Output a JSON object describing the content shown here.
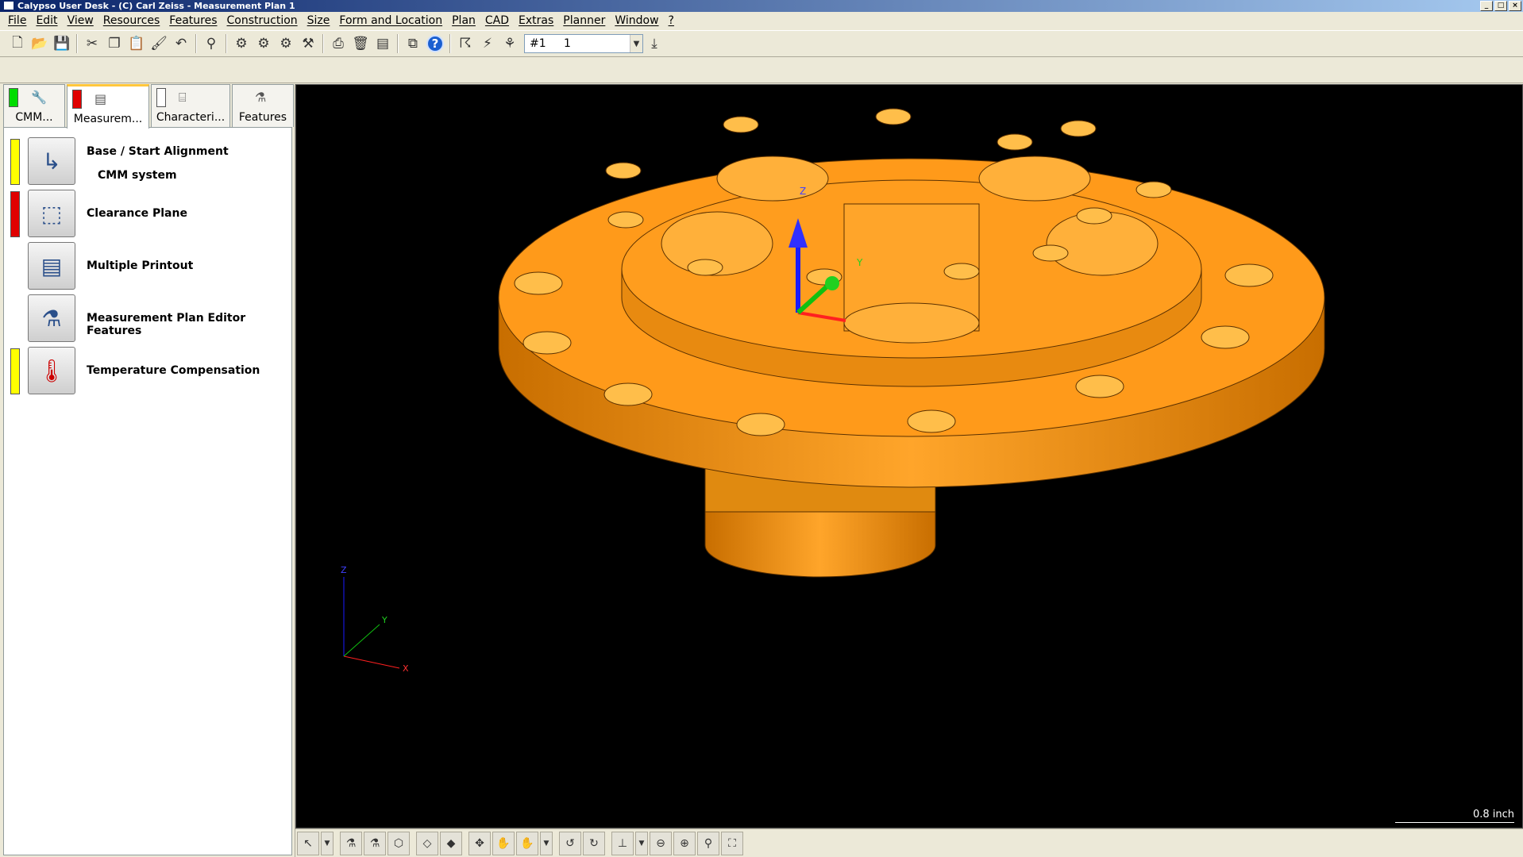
{
  "window": {
    "title": "Calypso User Desk - (C) Carl Zeiss - Measurement Plan 1",
    "controls": [
      "_",
      "□",
      "×"
    ]
  },
  "menu": [
    "File",
    "Edit",
    "View",
    "Resources",
    "Features",
    "Construction",
    "Size",
    "Form and Location",
    "Plan",
    "CAD",
    "Extras",
    "Planner",
    "Window",
    "?"
  ],
  "toolbar": {
    "combo_id": "#1",
    "combo_value": "1"
  },
  "tabs": [
    {
      "label": "CMM...",
      "indicator_color": "#00dd00"
    },
    {
      "label": "Measurem...",
      "indicator_color": "#e00000"
    },
    {
      "label": "Characteri...",
      "indicator_color": "#ffffff"
    },
    {
      "label": "Features",
      "indicator_color": ""
    }
  ],
  "entries": [
    {
      "label": "Base / Start Alignment",
      "sublabel": "CMM system",
      "bar_color": "#ffff00",
      "icon": "alignment-icon"
    },
    {
      "label": "Clearance Plane",
      "bar_color": "#e00000",
      "icon": "clearance-plane-icon"
    },
    {
      "label": "Multiple Printout",
      "bar_color": "",
      "icon": "printout-icon"
    },
    {
      "label": "Measurement Plan Editor Features",
      "bar_color": "",
      "icon": "features-icon"
    },
    {
      "label": "Temperature Compensation",
      "bar_color": "#ffff00",
      "icon": "thermometer-icon"
    }
  ],
  "viewport": {
    "scale_label": "0.8 inch",
    "part_color": "#ff9a1a",
    "axis_labels": {
      "z": "Z",
      "y": "Y",
      "x": "X"
    }
  }
}
